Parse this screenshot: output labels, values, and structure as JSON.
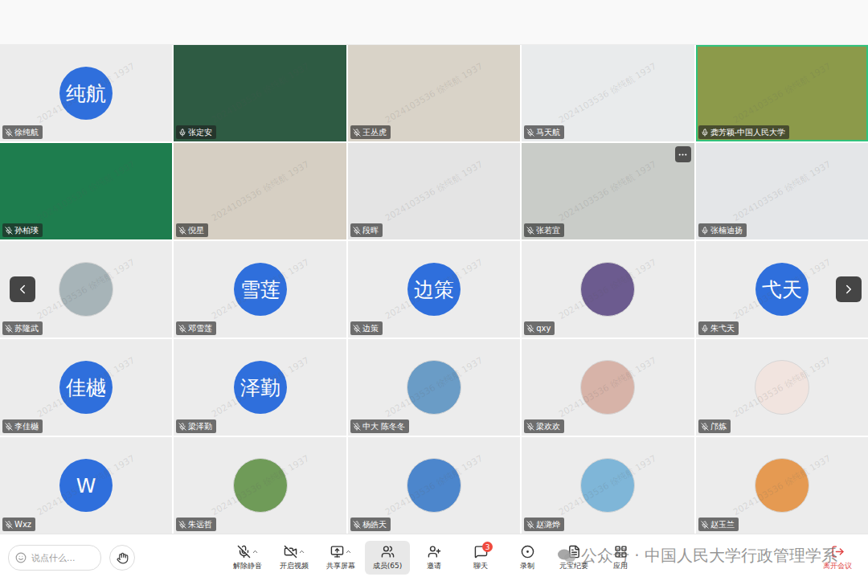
{
  "watermark": "2024103536 徐纯航 1937",
  "participants": [
    {
      "name": "徐纯航",
      "kind": "avatar",
      "avatar_text": "纯航",
      "muted": true,
      "speaking": false,
      "hovered": false
    },
    {
      "name": "张定安",
      "kind": "video",
      "color": "#2e5b43",
      "muted": false,
      "speaking": false,
      "hovered": false
    },
    {
      "name": "王丛虎",
      "kind": "video",
      "color": "#d9d3c8",
      "muted": true,
      "speaking": false,
      "hovered": false
    },
    {
      "name": "马天航",
      "kind": "video",
      "color": "#e9ebec",
      "muted": true,
      "speaking": false,
      "hovered": false
    },
    {
      "name": "龚芳颖-中国人民大学",
      "kind": "video",
      "color": "#8c9a4a",
      "muted": false,
      "speaking": true,
      "hovered": false
    },
    {
      "name": "孙柏瑛",
      "kind": "video",
      "color": "#1e7d4e",
      "muted": true,
      "speaking": false,
      "hovered": false
    },
    {
      "name": "倪星",
      "kind": "video",
      "color": "#d6cfc3",
      "muted": true,
      "speaking": false,
      "hovered": false
    },
    {
      "name": "段晖",
      "kind": "video",
      "color": "#e4e4e4",
      "muted": true,
      "speaking": false,
      "hovered": false
    },
    {
      "name": "张若宜",
      "kind": "video",
      "color": "#c9ccc8",
      "muted": true,
      "speaking": false,
      "hovered": true
    },
    {
      "name": "张楠迪扬",
      "kind": "video",
      "color": "#e4e6e8",
      "muted": false,
      "speaking": false,
      "hovered": false
    },
    {
      "name": "苏隆武",
      "kind": "image",
      "color": "#a7b4b8",
      "muted": true,
      "speaking": false,
      "hovered": false
    },
    {
      "name": "邓雪莲",
      "kind": "avatar",
      "avatar_text": "雪莲",
      "muted": true,
      "speaking": false,
      "hovered": false
    },
    {
      "name": "边策",
      "kind": "avatar",
      "avatar_text": "边策",
      "muted": true,
      "speaking": false,
      "hovered": false
    },
    {
      "name": "qxy",
      "kind": "image",
      "color": "#6c5b8f",
      "muted": true,
      "speaking": false,
      "hovered": false
    },
    {
      "name": "朱弋天",
      "kind": "avatar",
      "avatar_text": "弋天",
      "muted": false,
      "speaking": false,
      "hovered": false
    },
    {
      "name": "李佳樾",
      "kind": "avatar",
      "avatar_text": "佳樾",
      "muted": true,
      "speaking": false,
      "hovered": false
    },
    {
      "name": "梁泽勤",
      "kind": "avatar",
      "avatar_text": "泽勤",
      "muted": true,
      "speaking": false,
      "hovered": false
    },
    {
      "name": "中大 陈冬冬",
      "kind": "image",
      "color": "#6a9cc6",
      "muted": true,
      "speaking": false,
      "hovered": false
    },
    {
      "name": "梁欢欢",
      "kind": "image",
      "color": "#d7b3a8",
      "muted": true,
      "speaking": false,
      "hovered": false
    },
    {
      "name": "邝炼",
      "kind": "image",
      "color": "#f1e4df",
      "muted": true,
      "speaking": false,
      "hovered": false
    },
    {
      "name": "Wxz",
      "kind": "avatar",
      "avatar_text": "W",
      "muted": true,
      "speaking": false,
      "hovered": false
    },
    {
      "name": "朱远哲",
      "kind": "image",
      "color": "#6f9b58",
      "muted": true,
      "speaking": false,
      "hovered": false
    },
    {
      "name": "杨皓天",
      "kind": "image",
      "color": "#4c86cc",
      "muted": true,
      "speaking": false,
      "hovered": false
    },
    {
      "name": "赵潞烨",
      "kind": "image",
      "color": "#7fb6d8",
      "muted": true,
      "speaking": false,
      "hovered": false
    },
    {
      "name": "赵玉兰",
      "kind": "image",
      "color": "#e59a52",
      "muted": true,
      "speaking": false,
      "hovered": false
    }
  ],
  "chat_input": {
    "placeholder": "说点什么..."
  },
  "toolbar": [
    {
      "kind": "mute",
      "label": "解除静音",
      "has_menu": true,
      "selected": false,
      "badge": ""
    },
    {
      "kind": "video",
      "label": "开启视频",
      "has_menu": true,
      "selected": false,
      "badge": ""
    },
    {
      "kind": "share",
      "label": "共享屏幕",
      "has_menu": true,
      "selected": false,
      "badge": ""
    },
    {
      "kind": "members",
      "label": "成员(65)",
      "has_menu": false,
      "selected": true,
      "badge": ""
    },
    {
      "kind": "invite",
      "label": "邀请",
      "has_menu": false,
      "selected": false,
      "badge": ""
    },
    {
      "kind": "chat",
      "label": "聊天",
      "has_menu": false,
      "selected": false,
      "badge": "3"
    },
    {
      "kind": "record",
      "label": "录制",
      "has_menu": false,
      "selected": false,
      "badge": ""
    },
    {
      "kind": "summary",
      "label": "元宝纪要",
      "has_menu": false,
      "selected": false,
      "badge": ""
    },
    {
      "kind": "apps",
      "label": "应用",
      "has_menu": false,
      "selected": false,
      "badge": ""
    }
  ],
  "leave": {
    "label": "离开会议"
  },
  "caption": "公众号 · 中国人民大学行政管理学系"
}
